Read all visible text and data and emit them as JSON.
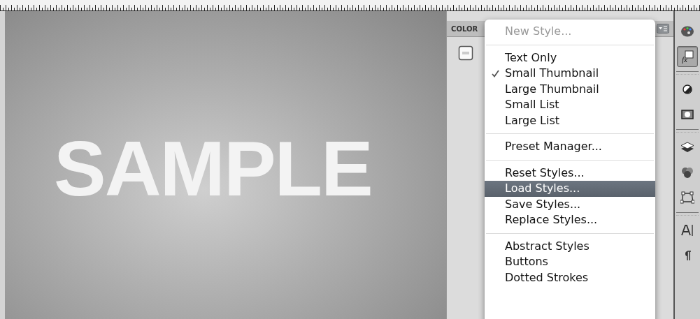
{
  "canvas": {
    "text": "SAMPLE"
  },
  "panel": {
    "tab": "COLOR"
  },
  "menu": {
    "items": [
      {
        "kind": "item",
        "label": "New Style...",
        "disabled": true,
        "checked": false,
        "selected": false
      },
      {
        "kind": "separator"
      },
      {
        "kind": "item",
        "label": "Text Only",
        "disabled": false,
        "checked": false,
        "selected": false
      },
      {
        "kind": "item",
        "label": "Small Thumbnail",
        "disabled": false,
        "checked": true,
        "selected": false
      },
      {
        "kind": "item",
        "label": "Large Thumbnail",
        "disabled": false,
        "checked": false,
        "selected": false
      },
      {
        "kind": "item",
        "label": "Small List",
        "disabled": false,
        "checked": false,
        "selected": false
      },
      {
        "kind": "item",
        "label": "Large List",
        "disabled": false,
        "checked": false,
        "selected": false
      },
      {
        "kind": "separator"
      },
      {
        "kind": "item",
        "label": "Preset Manager...",
        "disabled": false,
        "checked": false,
        "selected": false
      },
      {
        "kind": "separator"
      },
      {
        "kind": "item",
        "label": "Reset Styles...",
        "disabled": false,
        "checked": false,
        "selected": false
      },
      {
        "kind": "item",
        "label": "Load Styles...",
        "disabled": false,
        "checked": false,
        "selected": true
      },
      {
        "kind": "item",
        "label": "Save Styles...",
        "disabled": false,
        "checked": false,
        "selected": false
      },
      {
        "kind": "item",
        "label": "Replace Styles...",
        "disabled": false,
        "checked": false,
        "selected": false
      },
      {
        "kind": "separator"
      },
      {
        "kind": "item",
        "label": "Abstract Styles",
        "disabled": false,
        "checked": false,
        "selected": false
      },
      {
        "kind": "item",
        "label": "Buttons",
        "disabled": false,
        "checked": false,
        "selected": false
      },
      {
        "kind": "item",
        "label": "Dotted Strokes",
        "disabled": false,
        "checked": false,
        "selected": false
      }
    ]
  },
  "toolbar": {
    "tools": [
      {
        "kind": "palette",
        "selected": false
      },
      {
        "kind": "fx",
        "selected": true
      },
      {
        "kind": "divider"
      },
      {
        "kind": "halfcircle",
        "selected": false
      },
      {
        "kind": "mask",
        "selected": false
      },
      {
        "kind": "divider"
      },
      {
        "kind": "layers",
        "selected": false
      },
      {
        "kind": "channels",
        "selected": false
      },
      {
        "kind": "paths",
        "selected": false
      },
      {
        "kind": "divider"
      },
      {
        "kind": "character",
        "selected": false
      },
      {
        "kind": "paragraph",
        "selected": false
      }
    ]
  }
}
